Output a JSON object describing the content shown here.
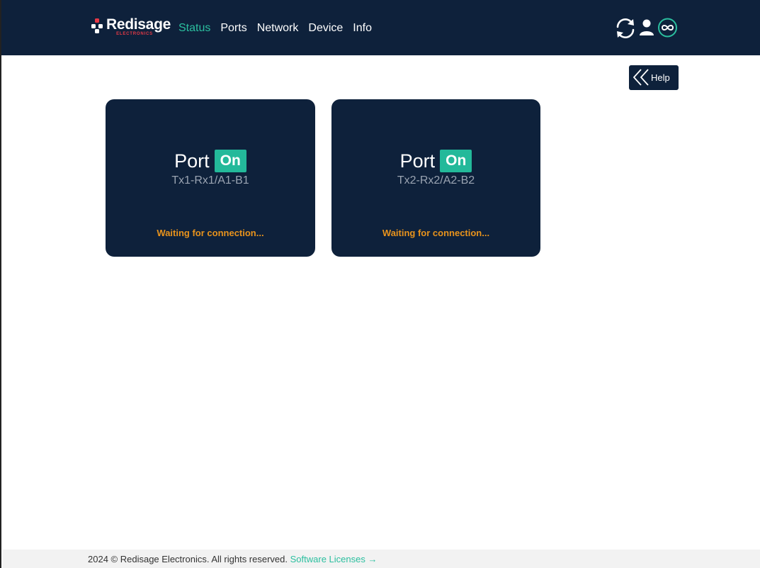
{
  "brand": {
    "name": "Redisage",
    "subtitle": "ELECTRONICS"
  },
  "nav": {
    "items": [
      {
        "label": "Status",
        "active": true
      },
      {
        "label": "Ports",
        "active": false
      },
      {
        "label": "Network",
        "active": false
      },
      {
        "label": "Device",
        "active": false
      },
      {
        "label": "Info",
        "active": false
      }
    ]
  },
  "header_icons": [
    "refresh-icon",
    "user-icon",
    "infinity-icon"
  ],
  "help": {
    "label": "Help"
  },
  "ports": [
    {
      "title": "Port",
      "state": "On",
      "id": "Tx1-Rx1/A1-B1",
      "status": "Waiting for connection..."
    },
    {
      "title": "Port",
      "state": "On",
      "id": "Tx2-Rx2/A2-B2",
      "status": "Waiting for connection..."
    }
  ],
  "footer": {
    "copyright": "2024 © Redisage Electronics. All rights reserved.",
    "link_label": "Software Licenses →"
  },
  "colors": {
    "navy": "#0e213b",
    "accent": "#2bbf9f",
    "on_badge": "#23b99a",
    "warning": "#e8931c",
    "brand_red": "#e63946"
  }
}
